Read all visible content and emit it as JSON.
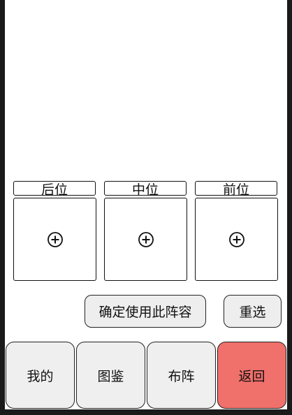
{
  "positions": {
    "back": "后位",
    "middle": "中位",
    "front": "前位"
  },
  "slots": {
    "empty_icon": "add-circle-icon"
  },
  "actions": {
    "confirm_label": "确定使用此阵容",
    "reselect_label": "重选"
  },
  "nav": {
    "items": [
      "我的",
      "图鉴",
      "布阵",
      "返回"
    ],
    "active": "返回",
    "active_color": "#f0706b"
  }
}
